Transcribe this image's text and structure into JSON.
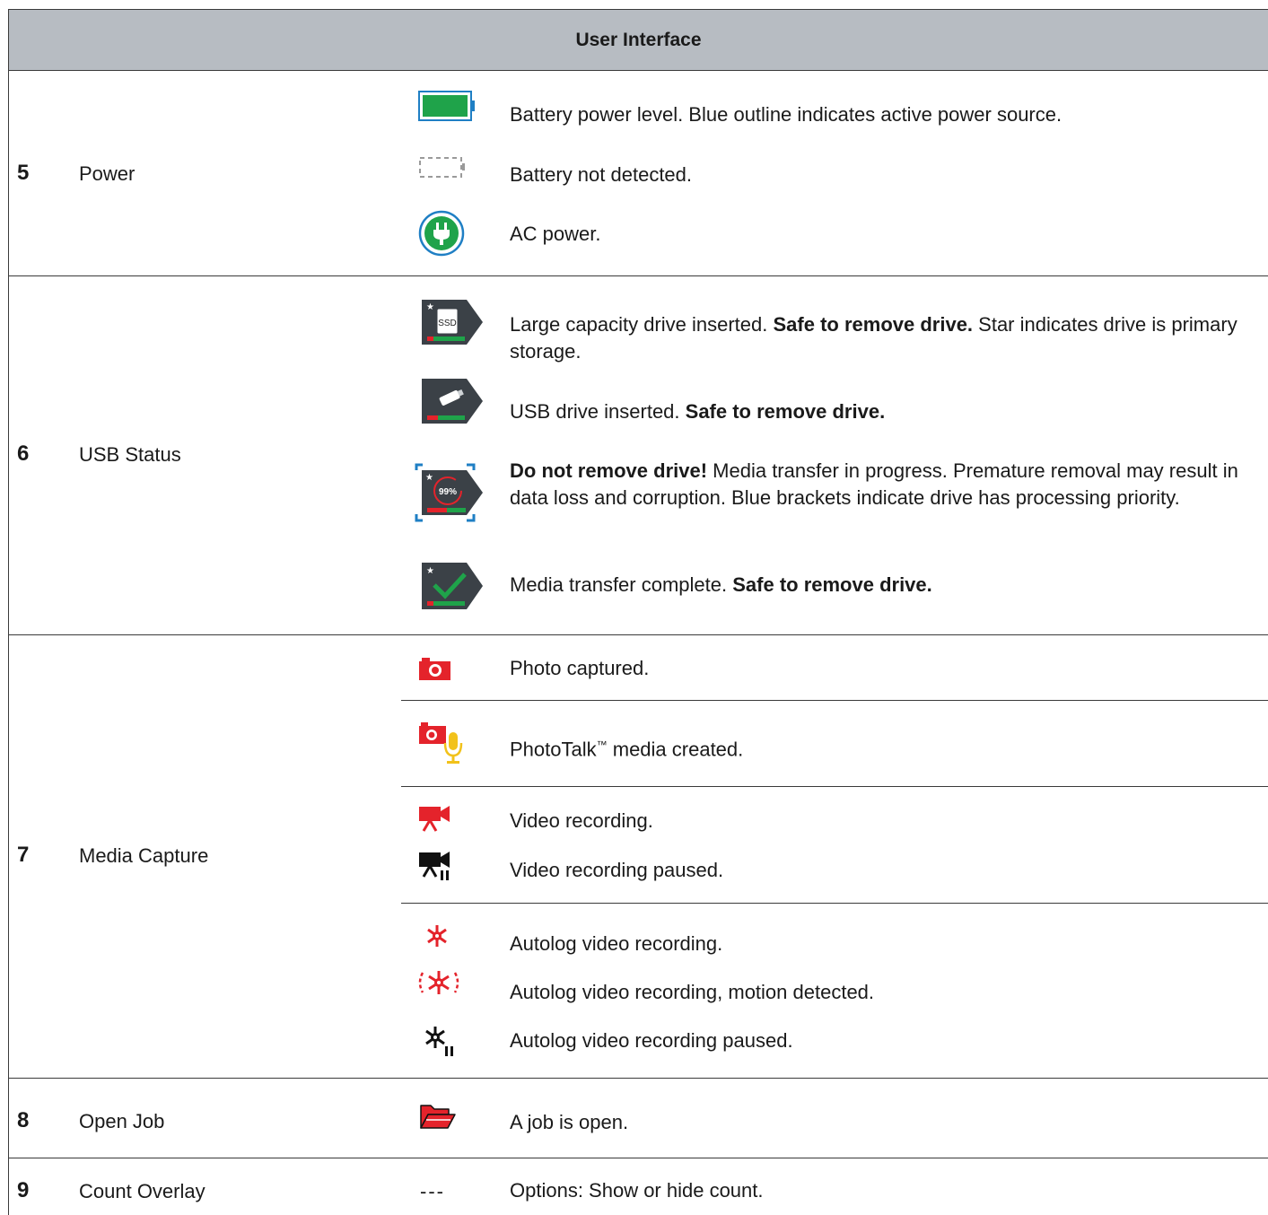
{
  "header": {
    "title": "User Interface"
  },
  "sections": [
    {
      "number": "5",
      "label": "Power"
    },
    {
      "number": "6",
      "label": "USB Status"
    },
    {
      "number": "7",
      "label": "Media Capture"
    },
    {
      "number": "8",
      "label": "Open Job"
    },
    {
      "number": "9",
      "label": "Count Overlay"
    }
  ],
  "power": {
    "battery_level": "Battery power level. Blue outline indicates active power source.",
    "battery_missing": "Battery not detected.",
    "ac_power": "AC power."
  },
  "usb": {
    "large_drive": {
      "pre": "Large capacity drive inserted. ",
      "bold": "Safe to remove drive.",
      "post": " Star indicates drive is primary storage.",
      "badge": "SSD"
    },
    "usb_drive": {
      "pre": "USB drive inserted. ",
      "bold": "Safe to remove drive."
    },
    "transfer": {
      "bold": "Do not remove drive!",
      "post": " Media transfer in progress. Premature removal may result in data loss and corruption. Blue brackets indicate drive has processing priority.",
      "progress_label": "99%"
    },
    "complete": {
      "pre": "Media transfer complete. ",
      "bold": "Safe to remove drive."
    }
  },
  "media": {
    "photo": "Photo captured.",
    "phototalk": "PhotoTalk",
    "phototalk_tm": "™",
    "phototalk_post": " media created.",
    "video": "Video recording.",
    "video_paused": "Video recording paused.",
    "autolog": "Autolog video recording.",
    "autolog_motion": "Autolog video recording, motion detected.",
    "autolog_paused": "Autolog video recording paused."
  },
  "job": {
    "open": "A job is open."
  },
  "count": {
    "dash": "---",
    "options": "Options: Show or hide count."
  },
  "colors": {
    "header_bg": "#b7bcc2",
    "green": "#1fa34a",
    "blue": "#1f7fc4",
    "red": "#e4232b",
    "dark": "#3b4147",
    "yellow": "#f2c21b"
  }
}
